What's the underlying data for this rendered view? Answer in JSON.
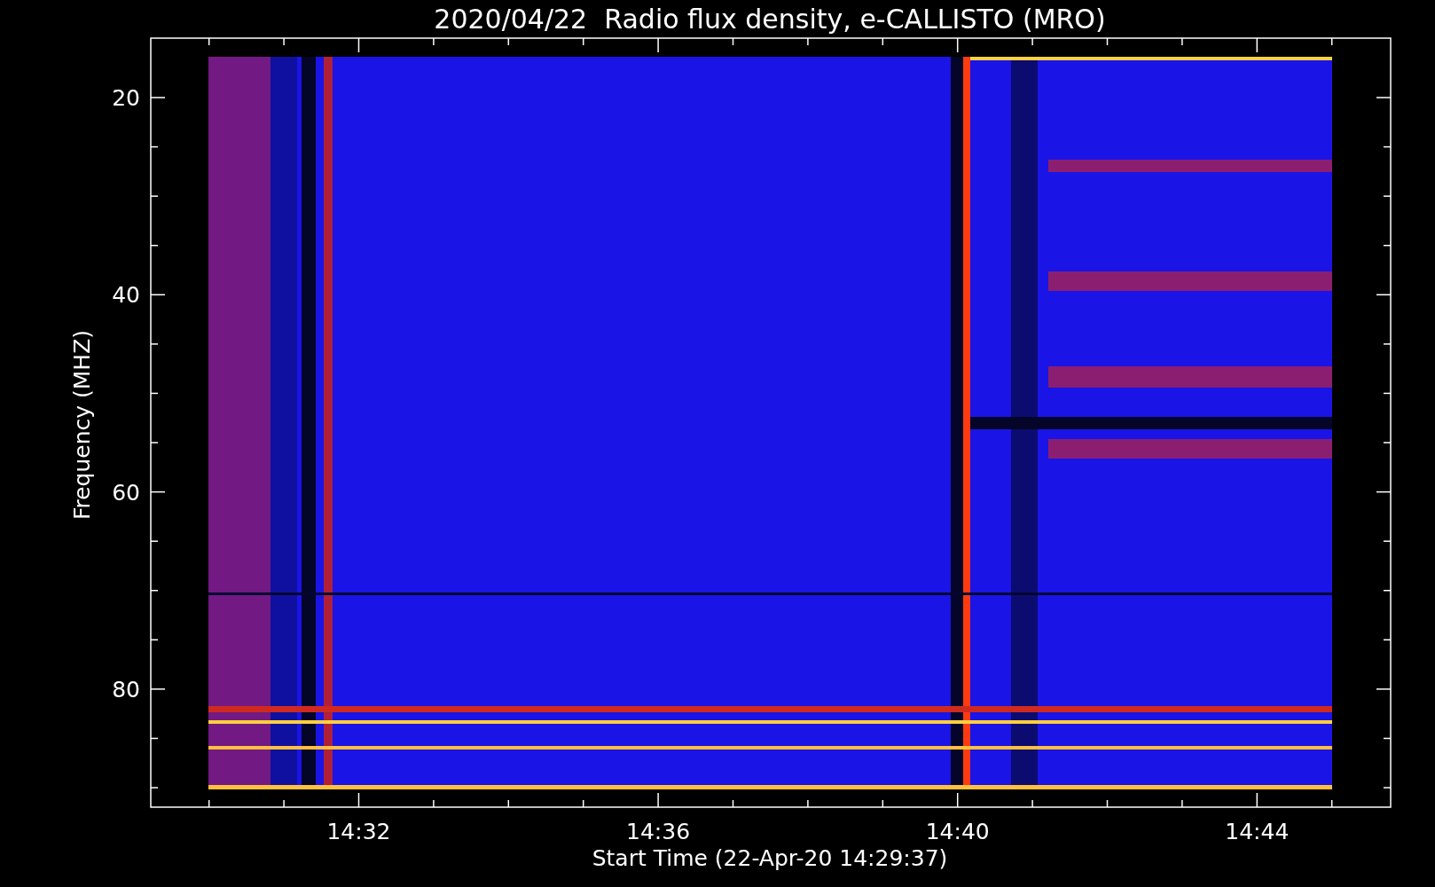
{
  "title": "2020/04/22  Radio flux density, e-CALLISTO (MRO)",
  "y_axis": {
    "label": "Frequency (MHZ)",
    "ticks": [
      "20",
      "40",
      "60",
      "80"
    ]
  },
  "x_axis": {
    "label": "Start Time (22-Apr-20 14:29:37)",
    "ticks": [
      "14:32",
      "14:36",
      "14:40",
      "14:44"
    ]
  }
}
